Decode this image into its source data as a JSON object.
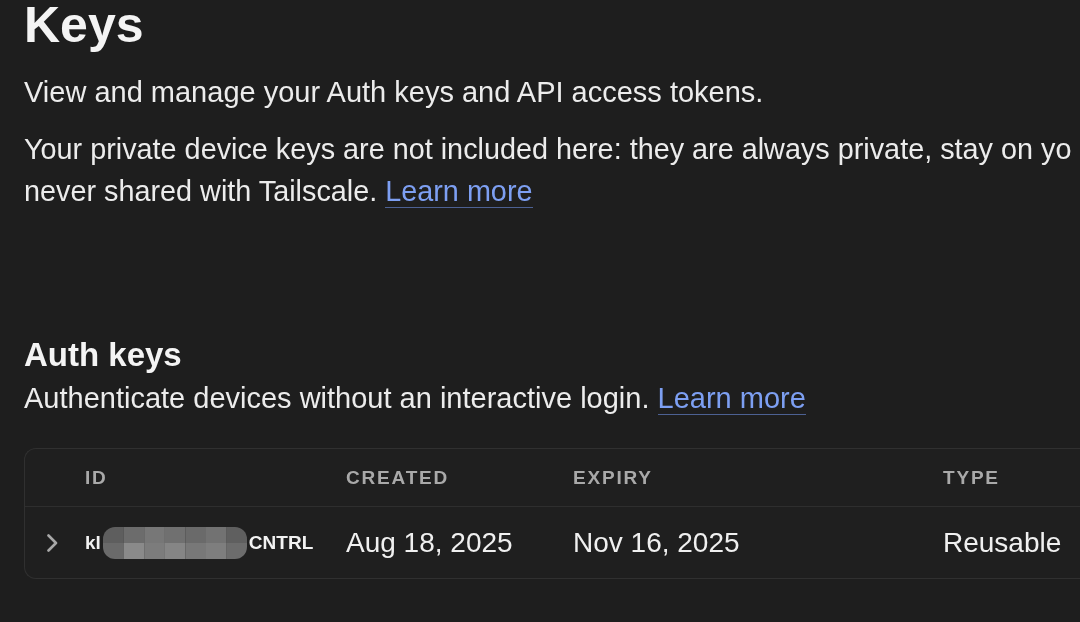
{
  "page": {
    "title": "Keys",
    "intro": "View and manage your Auth keys and API access tokens.",
    "note": {
      "lines": [
        "Your private device keys are not included here: they are always private, stay on yo",
        "never shared with Tailscale."
      ],
      "link": "Learn more"
    }
  },
  "auth_keys": {
    "title": "Auth keys",
    "description": "Authenticate devices without an interactive login.",
    "link": "Learn more",
    "table": {
      "columns": [
        "ID",
        "CREATED",
        "EXPIRY",
        "TYPE"
      ],
      "rows": [
        {
          "expanded": false,
          "id": {
            "start": "kl",
            "redacted": true,
            "end": "CNTRL"
          },
          "created": "Aug 18, 2025",
          "expiry": "Nov 16, 2025",
          "type": "Reusable"
        }
      ]
    }
  }
}
